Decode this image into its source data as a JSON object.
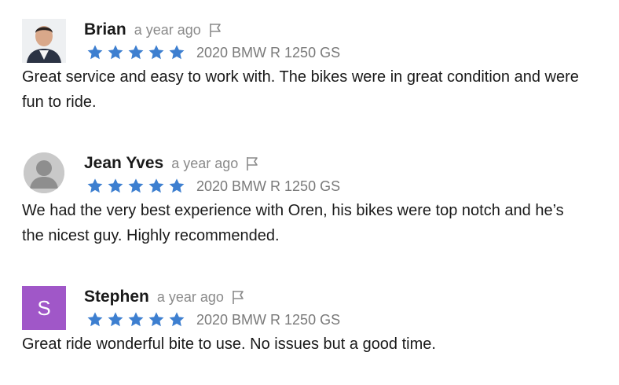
{
  "reviews": [
    {
      "name": "Brian",
      "time": "a year ago",
      "avatar_type": "photo",
      "avatar_letter": "",
      "rating": 5,
      "vehicle": "2020 BMW R 1250 GS",
      "text": "Great service and easy to work with. The bikes were in great condition and were fun to ride."
    },
    {
      "name": "Jean Yves",
      "time": "a year ago",
      "avatar_type": "generic",
      "avatar_letter": "",
      "rating": 5,
      "vehicle": "2020 BMW R 1250 GS",
      "text": "We had the very best experience with Oren, his bikes were top notch and he’s the nicest guy. Highly recommended."
    },
    {
      "name": "Stephen",
      "time": "a year ago",
      "avatar_type": "letter",
      "avatar_letter": "S",
      "rating": 5,
      "vehicle": "2020 BMW R 1250 GS",
      "text": "Great ride wonderful bite to use. No issues but a good time."
    }
  ],
  "colors": {
    "star": "#3d7fd0",
    "letter_avatar": "#a057c8",
    "muted_text": "#8a8a8a"
  },
  "icons": {
    "flag": "flag-icon",
    "star": "star-icon"
  }
}
